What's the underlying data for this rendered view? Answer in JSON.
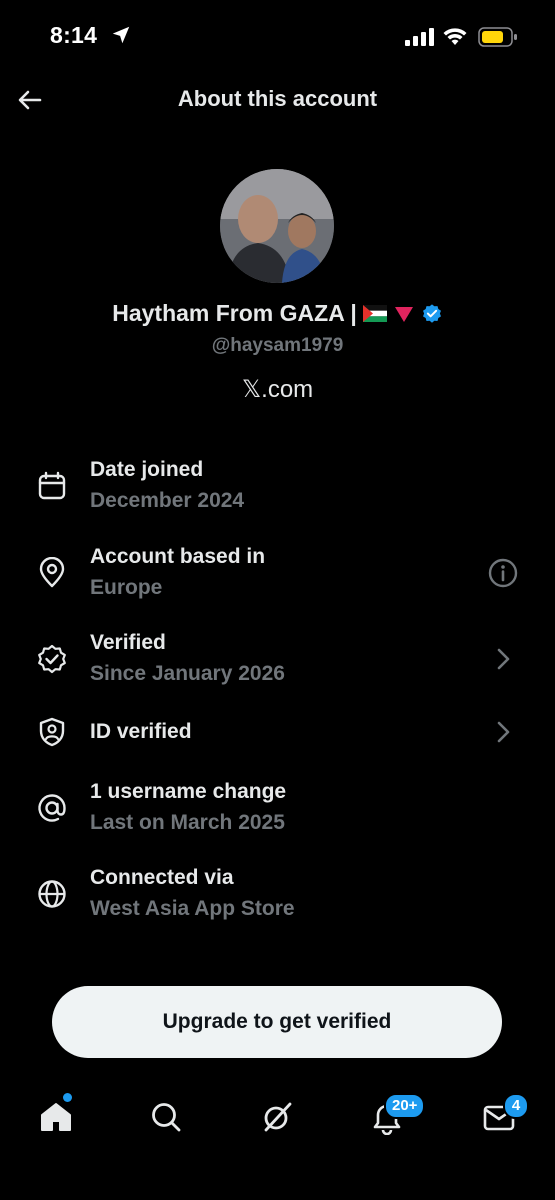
{
  "status_bar": {
    "time": "8:14"
  },
  "header": {
    "title": "About this account"
  },
  "profile": {
    "display_name": "Haytham From GAZA |",
    "handle": "@haysam1979",
    "site": "𝕏.com"
  },
  "info_rows": [
    {
      "icon": "calendar-icon",
      "title": "Date joined",
      "subtitle": "December 2024",
      "trailing": null
    },
    {
      "icon": "location-pin-icon",
      "title": "Account based in",
      "subtitle": "Europe",
      "trailing": "info-icon"
    },
    {
      "icon": "verified-badge-outline-icon",
      "title": "Verified",
      "subtitle": "Since January 2026",
      "trailing": "chevron-right-icon"
    },
    {
      "icon": "id-shield-icon",
      "title": "ID verified",
      "subtitle": "",
      "trailing": "chevron-right-icon"
    },
    {
      "icon": "at-sign-icon",
      "title": "1 username change",
      "subtitle": "Last on March 2025",
      "trailing": null
    },
    {
      "icon": "globe-icon",
      "title": "Connected via",
      "subtitle": "West Asia App Store",
      "trailing": null
    }
  ],
  "upgrade_button": {
    "label": "Upgrade to get verified"
  },
  "tab_bar": {
    "notifications_badge": "20+",
    "messages_badge": "4"
  },
  "colors": {
    "background": "#000000",
    "primary_text": "#e7e9ea",
    "secondary_text": "#71767b",
    "accent": "#1d9bf0",
    "button_bg": "#eff3f4"
  }
}
